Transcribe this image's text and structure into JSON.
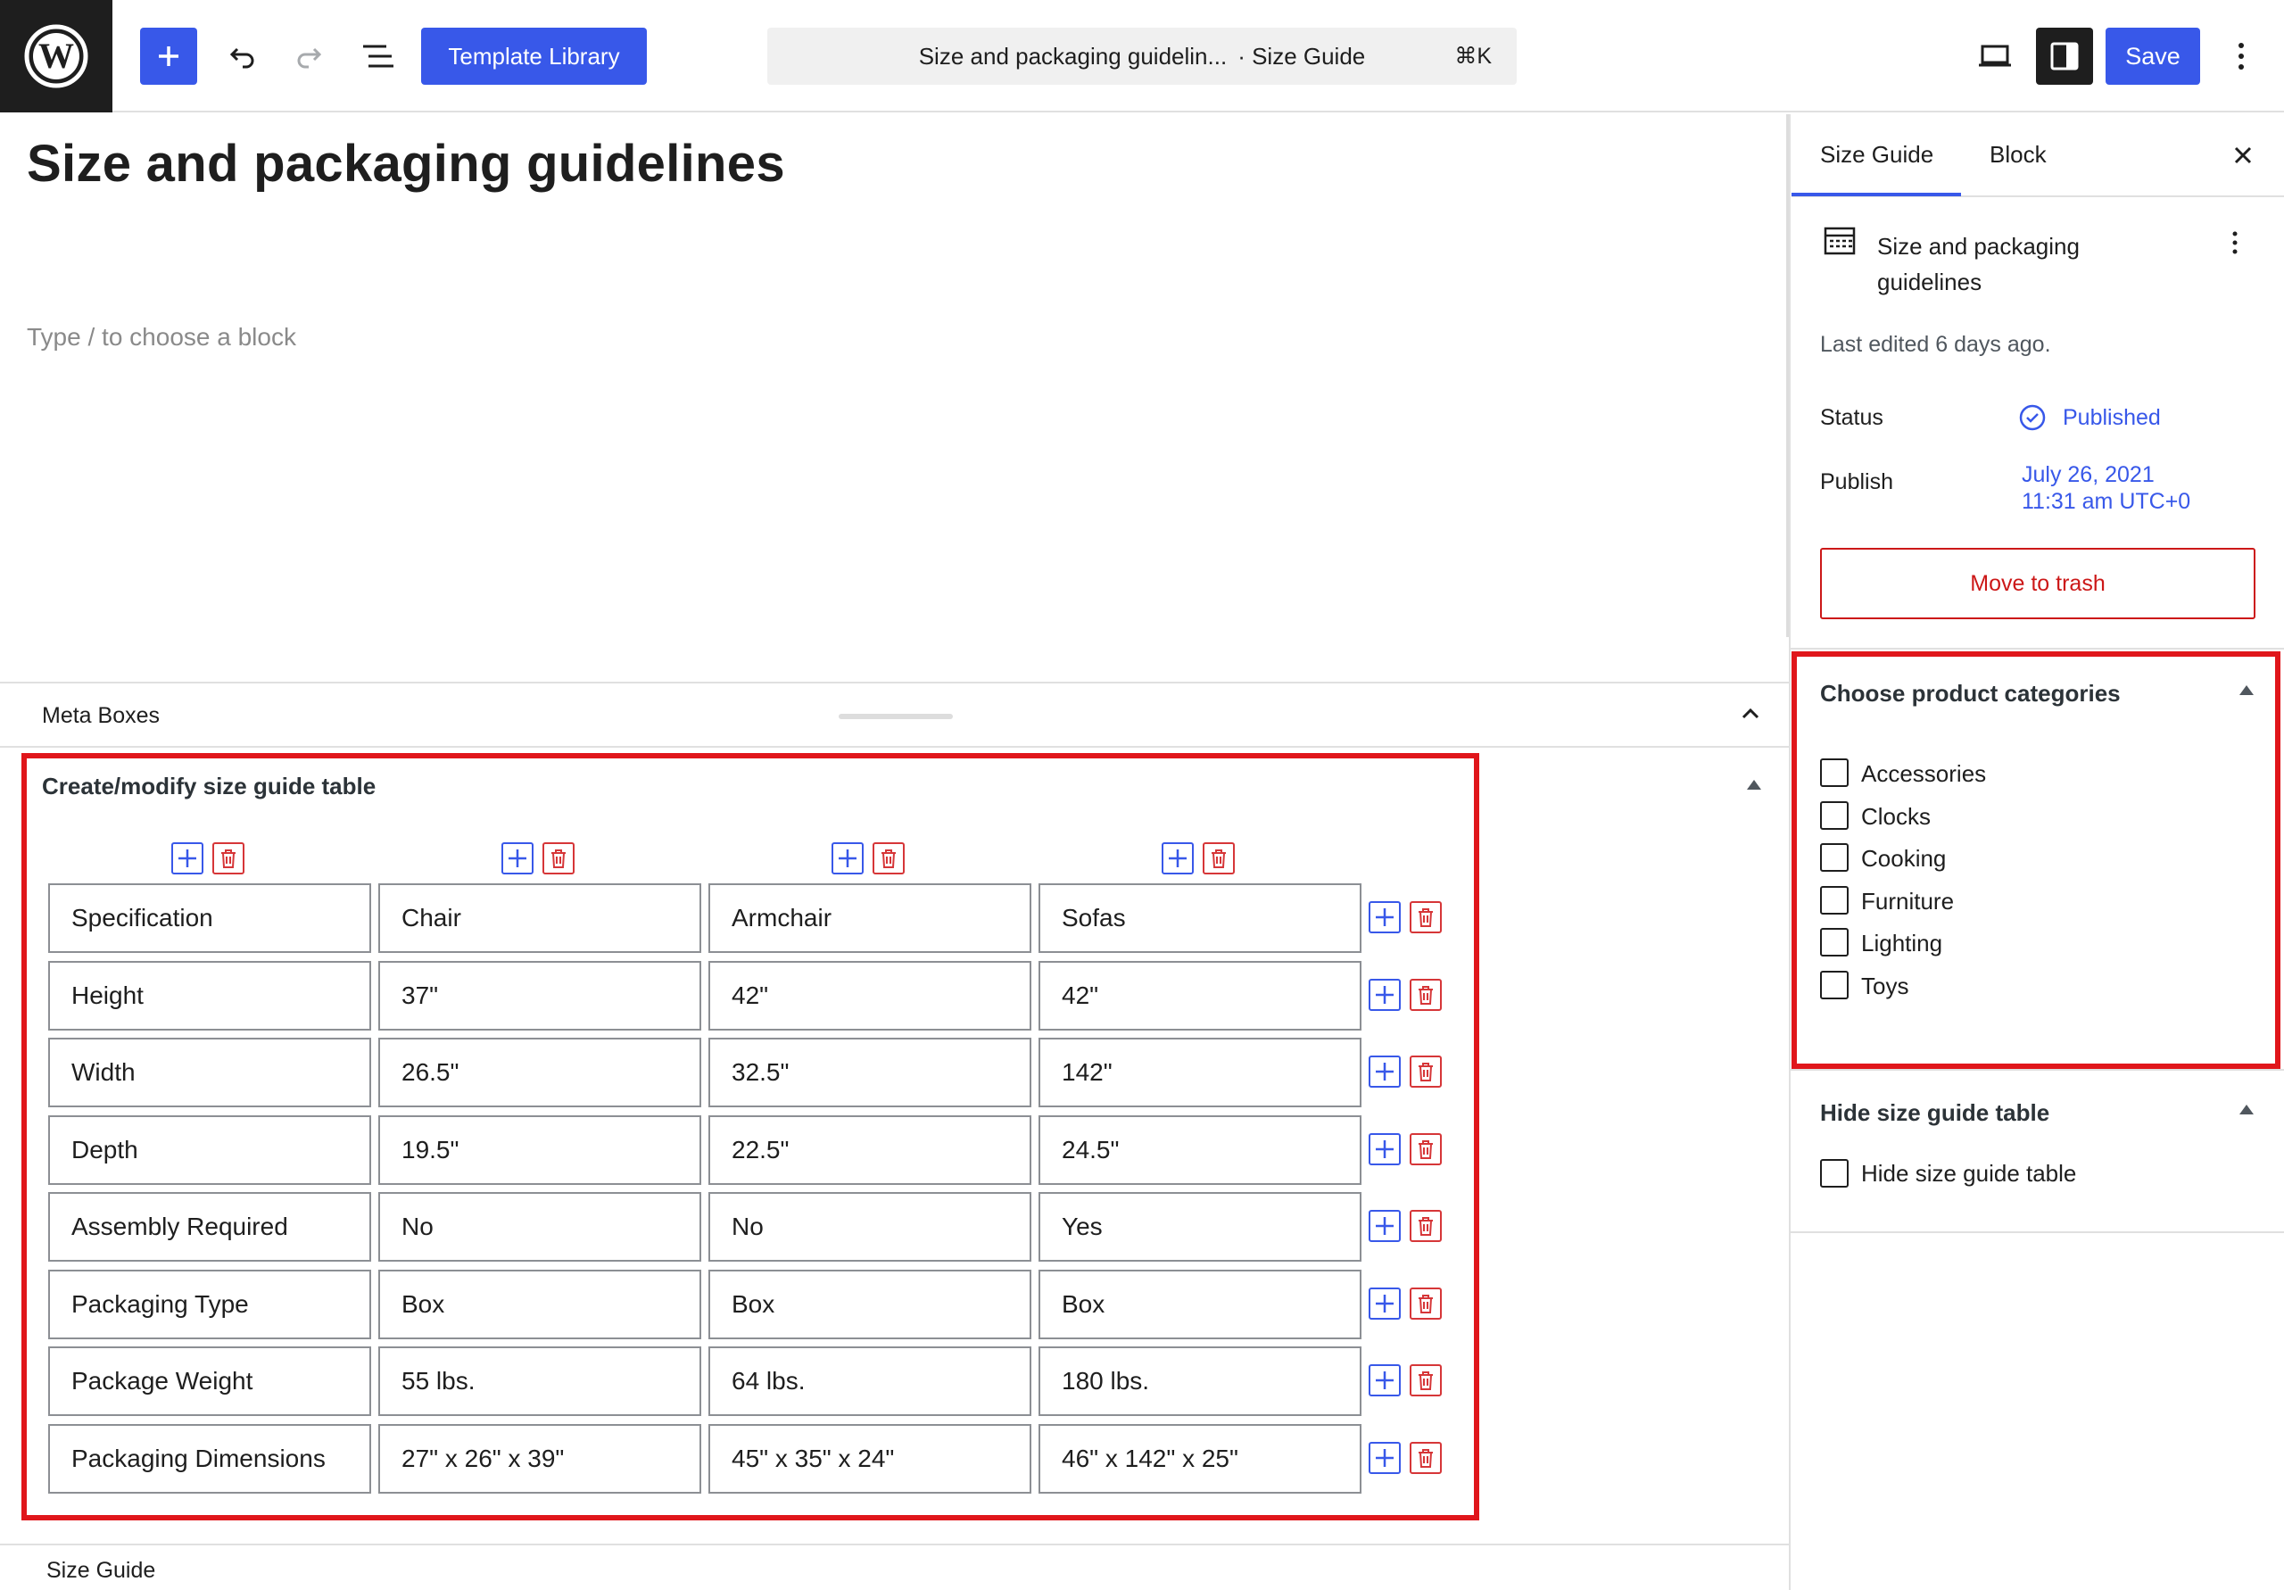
{
  "toolbar": {
    "template_library_label": "Template Library",
    "command": {
      "title": "Size and packaging guidelin...",
      "type": "· Size Guide",
      "shortcut": "⌘K"
    },
    "save_label": "Save"
  },
  "editor": {
    "title": "Size and packaging guidelines",
    "placeholder": "Type / to choose a block"
  },
  "meta_boxes": {
    "label": "Meta Boxes",
    "size_table": {
      "title": "Create/modify size guide table",
      "rows": [
        [
          "Specification",
          "Chair",
          "Armchair",
          "Sofas"
        ],
        [
          "Height",
          "37\"",
          "42\"",
          "42\""
        ],
        [
          "Width",
          "26.5\"",
          "32.5\"",
          "142\""
        ],
        [
          "Depth",
          "19.5\"",
          "22.5\"",
          "24.5\""
        ],
        [
          "Assembly Required",
          "No",
          "No",
          "Yes"
        ],
        [
          "Packaging Type",
          "Box",
          "Box",
          "Box"
        ],
        [
          "Package Weight",
          "55 lbs.",
          "64 lbs.",
          "180 lbs."
        ],
        [
          "Packaging Dimensions",
          "27\" x 26\" x 39\"",
          "45\" x 35\" x 24\"",
          "46\" x 142\" x 25\""
        ]
      ]
    }
  },
  "statusbar": {
    "label": "Size Guide"
  },
  "sidebar": {
    "tabs": [
      "Size Guide",
      "Block"
    ],
    "doc_title": "Size and packaging guidelines",
    "last_edited": "Last edited 6 days ago.",
    "status_label": "Status",
    "status_value": "Published",
    "publish_label": "Publish",
    "publish_date": "July 26, 2021",
    "publish_time": "11:31 am UTC+0",
    "trash_label": "Move to trash",
    "categories": {
      "title": "Choose product categories",
      "items": [
        "Accessories",
        "Clocks",
        "Cooking",
        "Furniture",
        "Lighting",
        "Toys"
      ]
    },
    "hide_table": {
      "title": "Hide size guide table",
      "checkbox_label": "Hide size guide table"
    }
  },
  "colors": {
    "accent": "#3858e9",
    "highlight": "#e0161b",
    "danger": "#d63638"
  }
}
